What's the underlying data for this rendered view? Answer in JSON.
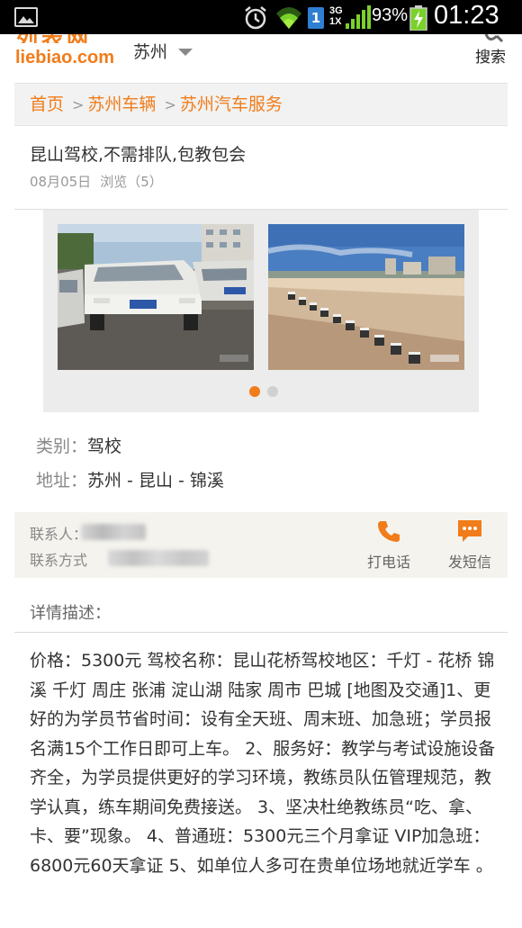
{
  "status_bar": {
    "network": "3G\n1X",
    "battery": "93%",
    "time": "01:23",
    "sim": "1"
  },
  "header": {
    "logo": "liebiao.com",
    "city": "苏州",
    "search_label": "搜索",
    "accent_color": "#f07c1a"
  },
  "breadcrumb": {
    "items": [
      "首页",
      "苏州车辆",
      "苏州汽车服务"
    ],
    "separator": ">"
  },
  "listing": {
    "title": "昆山驾校,不需排队,包教包会",
    "date": "08月05日",
    "views": "浏览（5）"
  },
  "gallery": {
    "photo_count": 2,
    "active_index": 0
  },
  "attributes": [
    {
      "key": "类别：",
      "value": "驾校"
    },
    {
      "key": "地址：",
      "value": "苏州 - 昆山 - 锦溪"
    }
  ],
  "contact": {
    "person_label": "联系人：",
    "method_label": "联系方式",
    "call_label": "打电话",
    "sms_label": "发短信"
  },
  "details": {
    "heading": "详情描述：",
    "text": "价格：5300元 驾校名称：昆山花桥驾校地区：千灯 - 花桥 锦溪 千灯 周庄 张浦 淀山湖 陆家 周市 巴城 [地图及交通]1、更好的为学员节省时间：设有全天班、周末班、加急班；学员报名满15个工作日即可上车。 2、服务好：教学与考试设施设备齐全，为学员提供更好的学习环境，教练员队伍管理规范，教学认真，练车期间免费接送。 3、坚决杜绝教练员“吃、拿、卡、要”现象。 4、普通班：5300元三个月拿证 VIP加急班：6800元60天拿证 5、如单位人多可在贵单位场地就近学车 。"
  }
}
